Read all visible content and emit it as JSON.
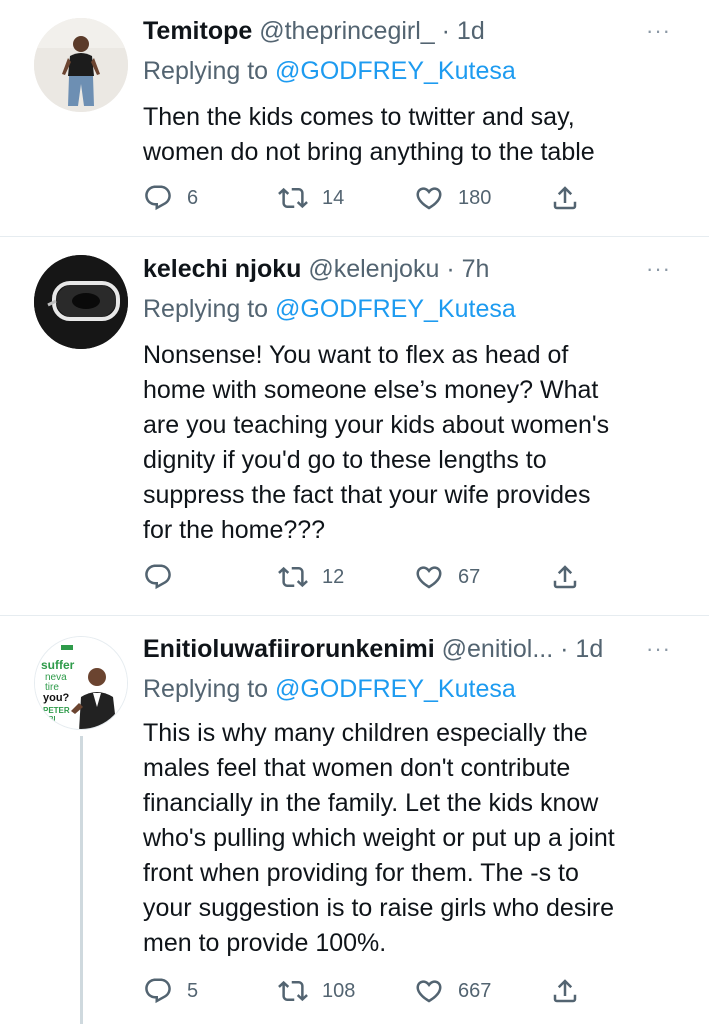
{
  "tweets": [
    {
      "name": "Temitope",
      "handle": "@theprincegirl_",
      "time": "1d",
      "replying_prefix": "Replying to ",
      "replying_to": "@GODFREY_Kutesa",
      "lines": [
        "Then the kids comes to twitter and say,",
        "women do not bring anything to the table"
      ],
      "replies": "6",
      "retweets": "14",
      "likes": "180"
    },
    {
      "name": "kelechi njoku",
      "handle": "@kelenjoku",
      "time": "7h",
      "replying_prefix": "Replying to ",
      "replying_to": "@GODFREY_Kutesa",
      "lines": [
        "Nonsense! You want to flex as head of",
        "home with someone else’s money? What",
        "are you teaching your kids about women's",
        "dignity if you'd go to these lengths to",
        "suppress the fact that your wife provides",
        "for the home???"
      ],
      "replies": "",
      "retweets": "12",
      "likes": "67"
    },
    {
      "name": "Enitioluwafiirorunkenimi",
      "handle": "@enitiol...",
      "time": "1d",
      "replying_prefix": "Replying to ",
      "replying_to": "@GODFREY_Kutesa",
      "avatar_text": [
        "suffer",
        "neva",
        "tire",
        "you?",
        "PETER",
        "OBI"
      ],
      "lines": [
        "This is why many children especially the",
        "males feel that women don't contribute",
        "financially in the family. Let the kids know",
        "who's pulling which weight or put up a joint",
        "front when providing for them. The -s to",
        "your suggestion is to raise girls who desire",
        "men to provide 100%."
      ],
      "replies": "5",
      "retweets": "108",
      "likes": "667"
    }
  ],
  "colors": {
    "text": "#0f1419",
    "secondary": "#536471",
    "link": "#1d9bf0",
    "divider": "#e6ecf0"
  },
  "icons": [
    "reply-icon",
    "retweet-icon",
    "like-icon",
    "share-icon",
    "more-icon"
  ]
}
